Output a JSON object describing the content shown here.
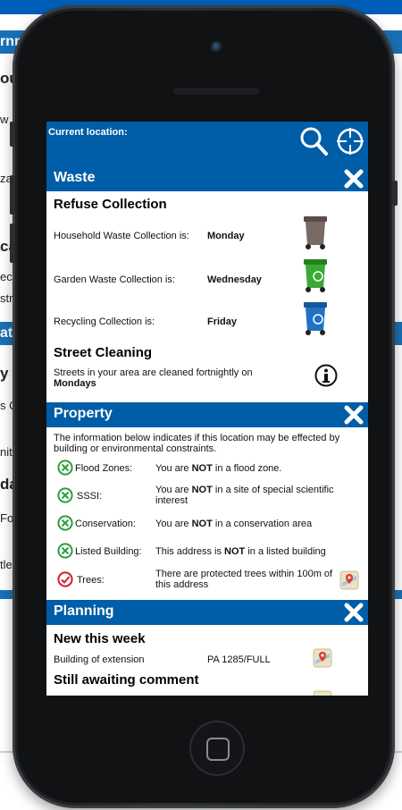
{
  "background": {
    "fragments": [
      "rnn",
      "ou",
      "w K",
      "za",
      "cal",
      "ect",
      "stri",
      "ati",
      "y",
      "s Cl",
      "nity",
      "da",
      "Fox",
      "tle"
    ]
  },
  "header": {
    "location_label": "Current location:",
    "search_icon": "search-icon",
    "locate_icon": "crosshair-icon"
  },
  "waste": {
    "title": "Waste",
    "refuse_heading": "Refuse Collection",
    "household_label": "Household Waste Collection is:",
    "household_day": "Monday",
    "garden_label": "Garden Waste Collection is:",
    "garden_day": "Wednesday",
    "recycling_label": "Recycling Collection is:",
    "recycling_day": "Friday",
    "street_heading": "Street Cleaning",
    "street_text": "Streets in your area are cleaned fortnightly on",
    "street_day": "Mondays",
    "bin_colors": {
      "household": "#7a6a64",
      "garden": "#3aa935",
      "recycling": "#1f72c4"
    }
  },
  "property": {
    "title": "Property",
    "intro": "The information below indicates if this location may be effected by building or environmental constraints.",
    "rows": [
      {
        "label": "Flood Zones:",
        "pre": "You are ",
        "strong": "NOT",
        "post": " in a flood zone.",
        "status": "ok"
      },
      {
        "label": "SSSI:",
        "pre": "You are ",
        "strong": "NOT",
        "post": " in a site of special scientific interest",
        "status": "ok"
      },
      {
        "label": "Conservation:",
        "pre": "You are ",
        "strong": "NOT",
        "post": " in a conservation area",
        "status": "ok"
      },
      {
        "label": "Listed Building:",
        "pre": "This address is ",
        "strong": "NOT",
        "post": " in a listed building",
        "status": "ok"
      },
      {
        "label": "Trees:",
        "pre": "There are protected trees within 100m of this address",
        "strong": "",
        "post": "",
        "status": "warn"
      }
    ]
  },
  "planning": {
    "title": "Planning",
    "new_heading": "New this week",
    "item_desc": "Building of extension",
    "item_ref": "PA 1285/FULL",
    "awaiting_heading": "Still awaiting comment"
  },
  "colors": {
    "brand": "#005da8",
    "ok": "#2e9e3e",
    "warn": "#d0202a"
  }
}
